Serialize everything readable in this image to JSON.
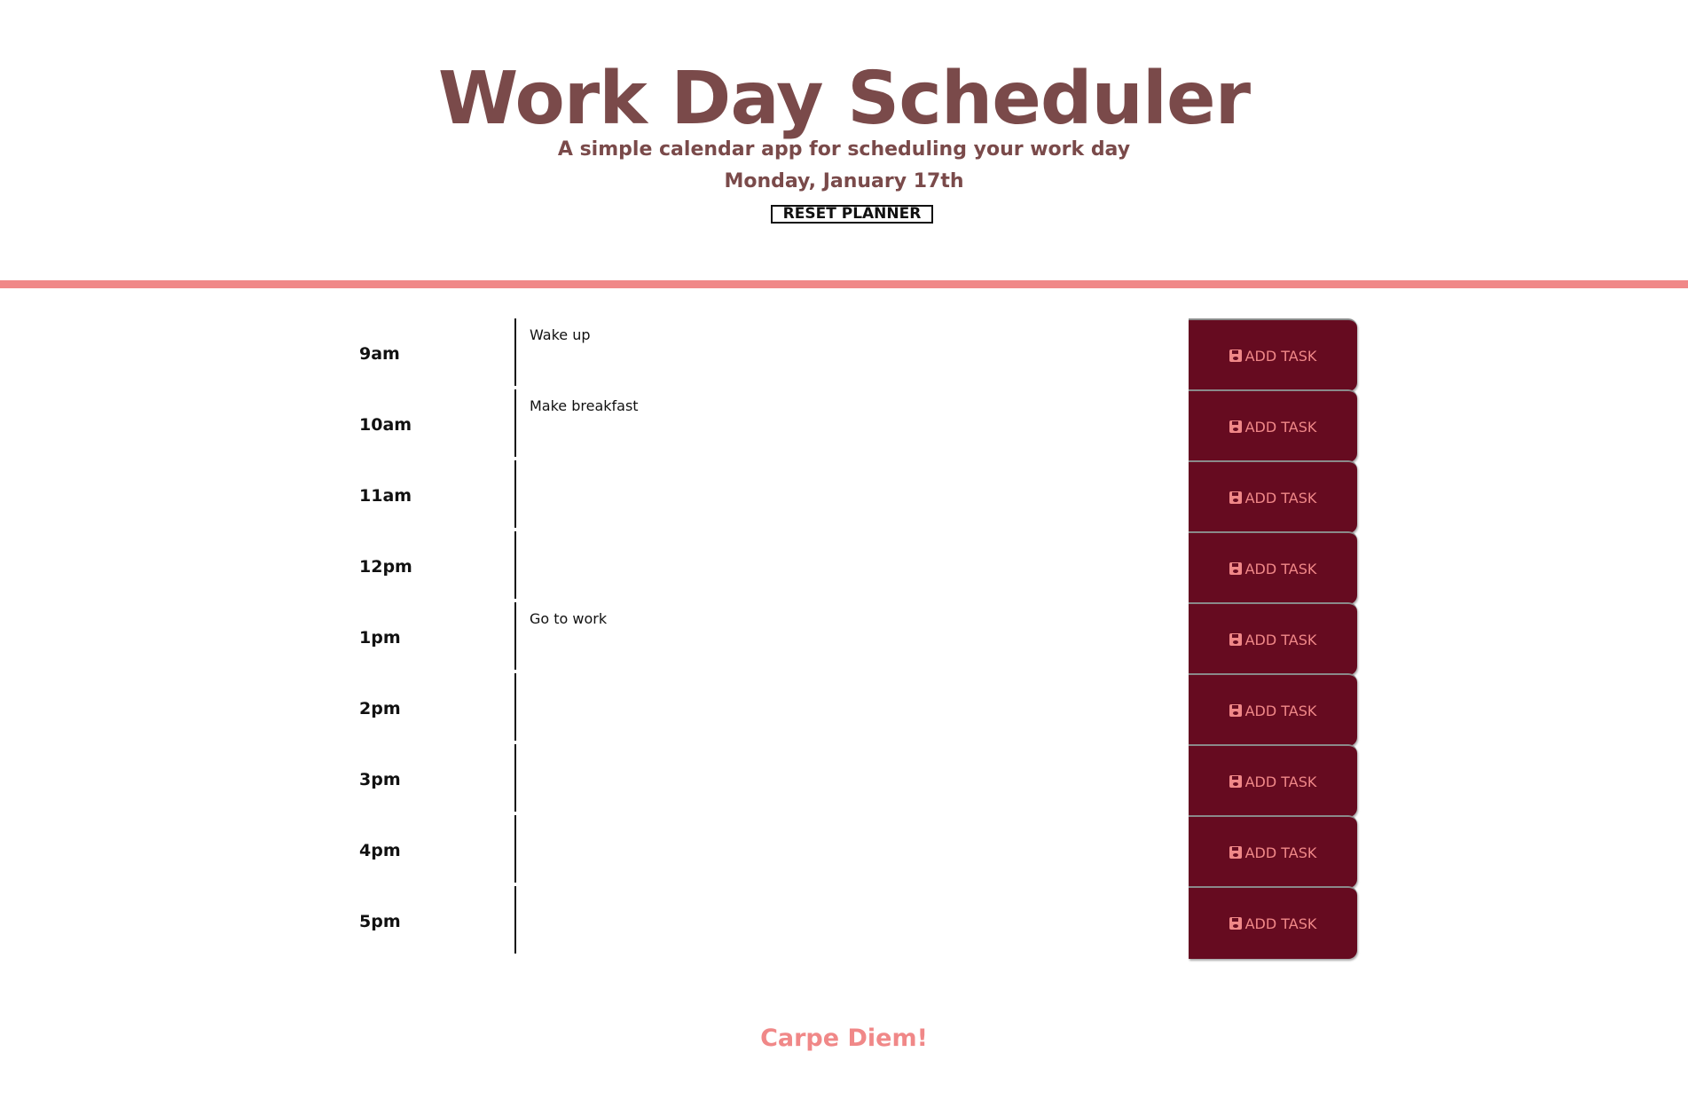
{
  "header": {
    "title": "Work Day Scheduler",
    "subtitle": "A simple calendar app for scheduling your work day",
    "date": "Monday, January 17th",
    "reset_label": "RESET PLANNER"
  },
  "planner": {
    "rows": [
      {
        "hour": "9am",
        "task": "Wake up",
        "button_label": "ADD TASK"
      },
      {
        "hour": "10am",
        "task": "Make breakfast",
        "button_label": "ADD TASK"
      },
      {
        "hour": "11am",
        "task": "",
        "button_label": "ADD TASK"
      },
      {
        "hour": "12pm",
        "task": "",
        "button_label": "ADD TASK"
      },
      {
        "hour": "1pm",
        "task": "Go to work",
        "button_label": "ADD TASK"
      },
      {
        "hour": "2pm",
        "task": "",
        "button_label": "ADD TASK"
      },
      {
        "hour": "3pm",
        "task": "",
        "button_label": "ADD TASK"
      },
      {
        "hour": "4pm",
        "task": "",
        "button_label": "ADD TASK"
      },
      {
        "hour": "5pm",
        "task": "",
        "button_label": "ADD TASK"
      }
    ],
    "button_icon": "save-icon"
  },
  "footer": {
    "text": "Carpe Diem!"
  },
  "colors": {
    "title": "#7a4a4a",
    "divider": "#f08888",
    "button_background": "#660b20",
    "button_text": "#f08888",
    "footer_text": "#f08888"
  }
}
